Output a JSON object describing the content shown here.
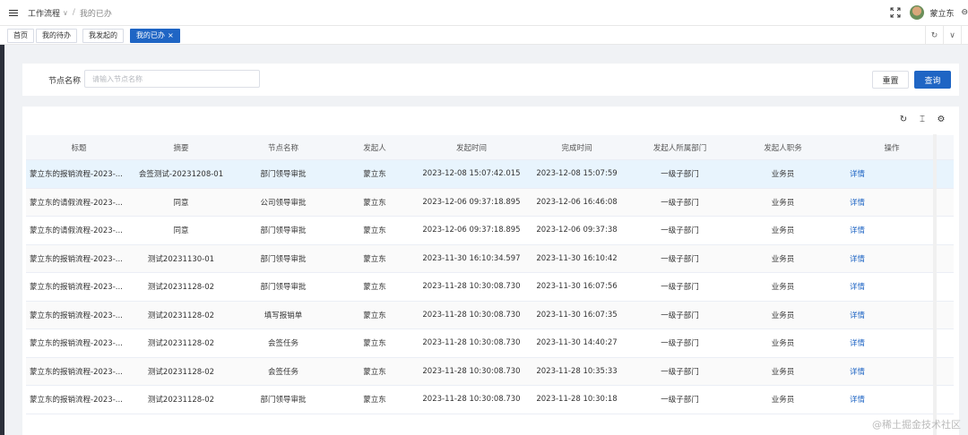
{
  "header": {
    "breadcrumb_root": "工作流程",
    "breadcrumb_current": "我的已办",
    "user_name": "蒙立东"
  },
  "tags": [
    {
      "label": "首页"
    },
    {
      "label": "我的待办"
    },
    {
      "label": "我发起的"
    },
    {
      "label": "我的已办",
      "active": true
    }
  ],
  "search": {
    "label": "节点名称",
    "placeholder": "请输入节点名称",
    "value": "",
    "reset_label": "重置",
    "query_label": "查询"
  },
  "table": {
    "columns": [
      "标题",
      "摘要",
      "节点名称",
      "发起人",
      "发起时间",
      "完成时间",
      "发起人所属部门",
      "发起人职务",
      "操作"
    ],
    "rows": [
      [
        "蒙立东的报销流程-2023-...",
        "会签测试-20231208-01",
        "部门领导审批",
        "蒙立东",
        "2023-12-08 15:07:42.015",
        "2023-12-08 15:07:59",
        "一级子部门",
        "业务员",
        "详情"
      ],
      [
        "蒙立东的请假流程-2023-...",
        "同意",
        "公司领导审批",
        "蒙立东",
        "2023-12-06 09:37:18.895",
        "2023-12-06 16:46:08",
        "一级子部门",
        "业务员",
        "详情"
      ],
      [
        "蒙立东的请假流程-2023-...",
        "同意",
        "部门领导审批",
        "蒙立东",
        "2023-12-06 09:37:18.895",
        "2023-12-06 09:37:38",
        "一级子部门",
        "业务员",
        "详情"
      ],
      [
        "蒙立东的报销流程-2023-...",
        "测试20231130-01",
        "部门领导审批",
        "蒙立东",
        "2023-11-30 16:10:34.597",
        "2023-11-30 16:10:42",
        "一级子部门",
        "业务员",
        "详情"
      ],
      [
        "蒙立东的报销流程-2023-...",
        "测试20231128-02",
        "部门领导审批",
        "蒙立东",
        "2023-11-28 10:30:08.730",
        "2023-11-30 16:07:56",
        "一级子部门",
        "业务员",
        "详情"
      ],
      [
        "蒙立东的报销流程-2023-...",
        "测试20231128-02",
        "填写报销单",
        "蒙立东",
        "2023-11-28 10:30:08.730",
        "2023-11-30 16:07:35",
        "一级子部门",
        "业务员",
        "详情"
      ],
      [
        "蒙立东的报销流程-2023-...",
        "测试20231128-02",
        "会签任务",
        "蒙立东",
        "2023-11-28 10:30:08.730",
        "2023-11-30 14:40:27",
        "一级子部门",
        "业务员",
        "详情"
      ],
      [
        "蒙立东的报销流程-2023-...",
        "测试20231128-02",
        "会签任务",
        "蒙立东",
        "2023-11-28 10:30:08.730",
        "2023-11-28 10:35:33",
        "一级子部门",
        "业务员",
        "详情"
      ],
      [
        "蒙立东的报销流程-2023-...",
        "测试20231128-02",
        "部门领导审批",
        "蒙立东",
        "2023-11-28 10:30:08.730",
        "2023-11-28 10:30:18",
        "一级子部门",
        "业务员",
        "详情"
      ]
    ]
  },
  "watermark": "@稀土掘金技术社区",
  "colors": {
    "primary": "#1f65c4",
    "selected_row": "#e8f4fd"
  }
}
